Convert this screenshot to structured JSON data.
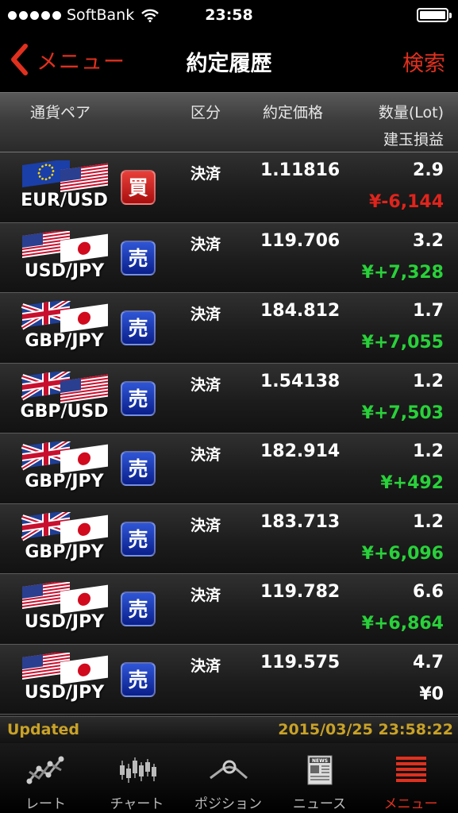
{
  "status_bar": {
    "carrier": "SoftBank",
    "time": "23:58",
    "signal_bars": 5,
    "battery_level": 1.0
  },
  "nav": {
    "back_label": "メニュー",
    "title": "約定履歴",
    "search_label": "検索"
  },
  "columns": {
    "pair": "通貨ペア",
    "kubun": "区分",
    "price": "約定価格",
    "qty": "数量(Lot)",
    "pnl": "建玉損益"
  },
  "rows": [
    {
      "pair": "EUR/USD",
      "side": "買",
      "side_type": "buy",
      "kubun": "決済",
      "price": "1.11816",
      "qty": "2.9",
      "pnl": "¥-6,144",
      "pnl_type": "neg",
      "flags": [
        "eu",
        "us"
      ]
    },
    {
      "pair": "USD/JPY",
      "side": "売",
      "side_type": "sell",
      "kubun": "決済",
      "price": "119.706",
      "qty": "3.2",
      "pnl": "¥+7,328",
      "pnl_type": "pos",
      "flags": [
        "us",
        "jp"
      ]
    },
    {
      "pair": "GBP/JPY",
      "side": "売",
      "side_type": "sell",
      "kubun": "決済",
      "price": "184.812",
      "qty": "1.7",
      "pnl": "¥+7,055",
      "pnl_type": "pos",
      "flags": [
        "gb",
        "jp"
      ]
    },
    {
      "pair": "GBP/USD",
      "side": "売",
      "side_type": "sell",
      "kubun": "決済",
      "price": "1.54138",
      "qty": "1.2",
      "pnl": "¥+7,503",
      "pnl_type": "pos",
      "flags": [
        "gb",
        "us"
      ]
    },
    {
      "pair": "GBP/JPY",
      "side": "売",
      "side_type": "sell",
      "kubun": "決済",
      "price": "182.914",
      "qty": "1.2",
      "pnl": "¥+492",
      "pnl_type": "pos",
      "flags": [
        "gb",
        "jp"
      ]
    },
    {
      "pair": "GBP/JPY",
      "side": "売",
      "side_type": "sell",
      "kubun": "決済",
      "price": "183.713",
      "qty": "1.2",
      "pnl": "¥+6,096",
      "pnl_type": "pos",
      "flags": [
        "gb",
        "jp"
      ]
    },
    {
      "pair": "USD/JPY",
      "side": "売",
      "side_type": "sell",
      "kubun": "決済",
      "price": "119.782",
      "qty": "6.6",
      "pnl": "¥+6,864",
      "pnl_type": "pos",
      "flags": [
        "us",
        "jp"
      ]
    },
    {
      "pair": "USD/JPY",
      "side": "売",
      "side_type": "sell",
      "kubun": "決済",
      "price": "119.575",
      "qty": "4.7",
      "pnl": "¥0",
      "pnl_type": "zero",
      "flags": [
        "us",
        "jp"
      ]
    }
  ],
  "updated": {
    "label": "Updated",
    "time": "2015/03/25 23:58:22"
  },
  "tabs": [
    {
      "label": "レート",
      "icon": "rate-chart-icon",
      "active": false
    },
    {
      "label": "チャート",
      "icon": "candlestick-icon",
      "active": false
    },
    {
      "label": "ポジション",
      "icon": "position-icon",
      "active": false
    },
    {
      "label": "ニュース",
      "icon": "news-icon",
      "active": false
    },
    {
      "label": "メニュー",
      "icon": "menu-list-icon",
      "active": true
    }
  ],
  "colors": {
    "accent": "#e0301e",
    "positive": "#29d13a",
    "negative": "#e0241c",
    "buy_badge": "#c41a14",
    "sell_badge": "#1a3cb0",
    "updated_text": "#c9a227"
  }
}
